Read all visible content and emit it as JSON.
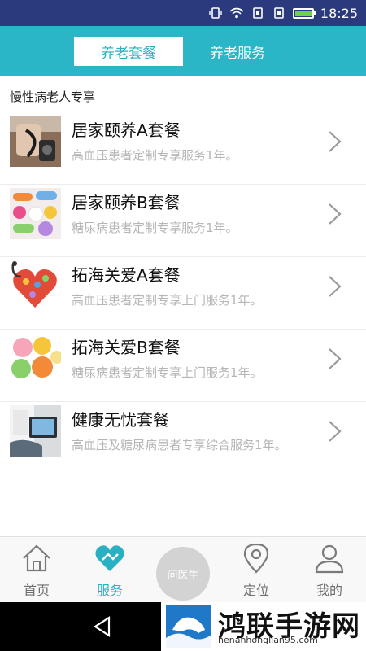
{
  "status_bar": {
    "time": "18:25"
  },
  "header": {
    "tabs": [
      {
        "label": "养老套餐",
        "active": true
      },
      {
        "label": "养老服务",
        "active": false
      }
    ]
  },
  "section": {
    "title": "慢性病老人专享"
  },
  "packages": [
    {
      "title": "居家颐养A套餐",
      "subtitle": "高血压患者定制专享服务1年。",
      "image": "blood-pressure-photo"
    },
    {
      "title": "居家颐养B套餐",
      "subtitle": "糖尿病患者定制专享服务1年。",
      "image": "pills-photo"
    },
    {
      "title": "拓海关爱A套餐",
      "subtitle": "高血压患者定制专享上门服务1年。",
      "image": "stethoscope-heart-photo"
    },
    {
      "title": "拓海关爱B套餐",
      "subtitle": "糖尿病患者定制专享上门服务1年。",
      "image": "candy-photo"
    },
    {
      "title": "健康无忧套餐",
      "subtitle": "高血压及糖尿病患者专享综合服务1年。",
      "image": "doctor-tablet-photo"
    }
  ],
  "bottom_nav": {
    "items": [
      {
        "label": "首页",
        "icon": "home-icon"
      },
      {
        "label": "服务",
        "icon": "heart-hand-icon",
        "active": true
      },
      {
        "label": "定位",
        "icon": "location-pin-icon"
      },
      {
        "label": "我的",
        "icon": "person-icon"
      }
    ],
    "center_button": "问医生"
  },
  "watermark": {
    "name": "鸿联手游网",
    "url": "henanhonglian95.com"
  },
  "colors": {
    "accent": "#2ab6c6",
    "status_bar": "#2a3a7c",
    "subtitle": "#b6b6b6"
  }
}
